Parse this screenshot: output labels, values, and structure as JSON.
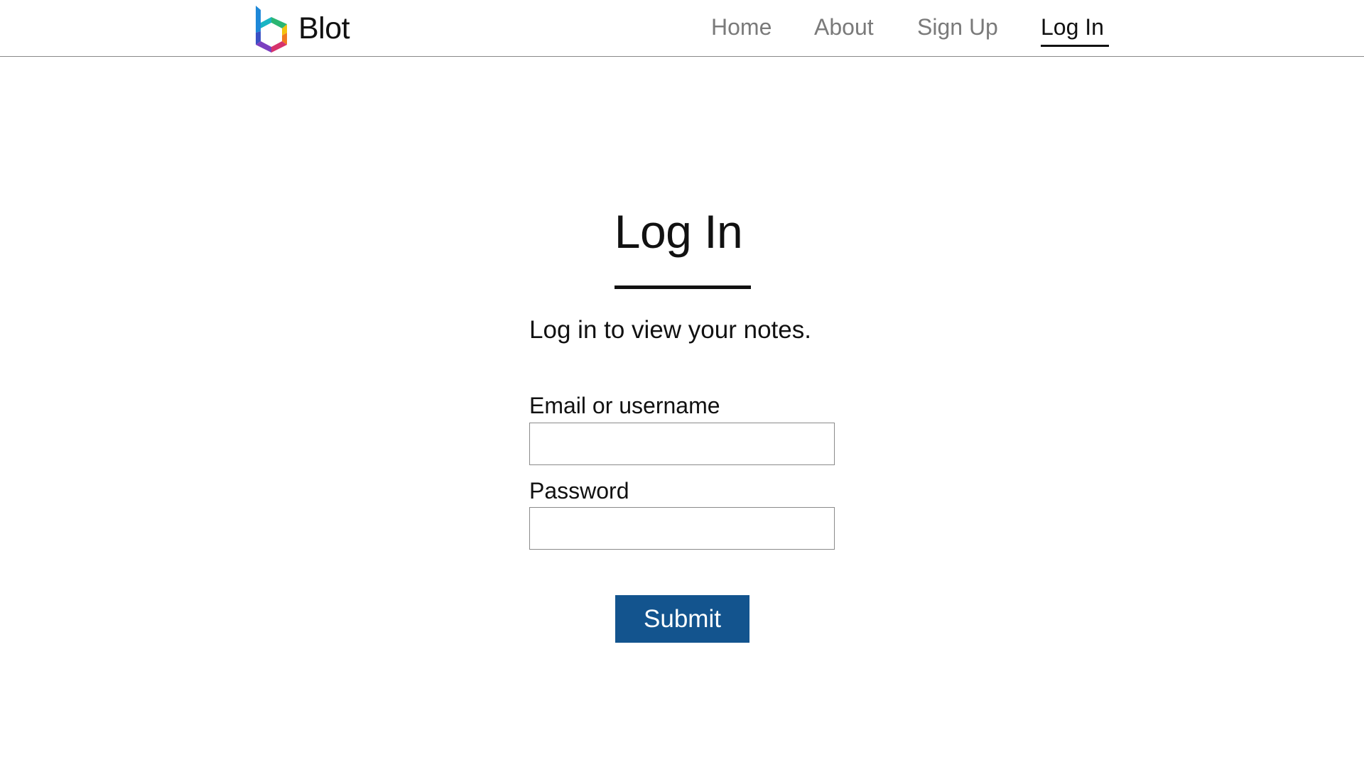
{
  "brand": {
    "name": "Blot",
    "logo_icon": "blot-logo-icon"
  },
  "nav": {
    "items": [
      {
        "label": "Home",
        "active": false
      },
      {
        "label": "About",
        "active": false
      },
      {
        "label": "Sign Up",
        "active": false
      },
      {
        "label": "Log In",
        "active": true
      }
    ]
  },
  "page": {
    "title": "Log In",
    "subtitle": "Log in to view your notes."
  },
  "form": {
    "email_label": "Email or username",
    "email_value": "",
    "password_label": "Password",
    "password_value": "",
    "submit_label": "Submit"
  },
  "colors": {
    "accent": "#13548e",
    "nav_inactive": "#7a7a7a",
    "text": "#111111",
    "border": "#8a8a8a"
  }
}
